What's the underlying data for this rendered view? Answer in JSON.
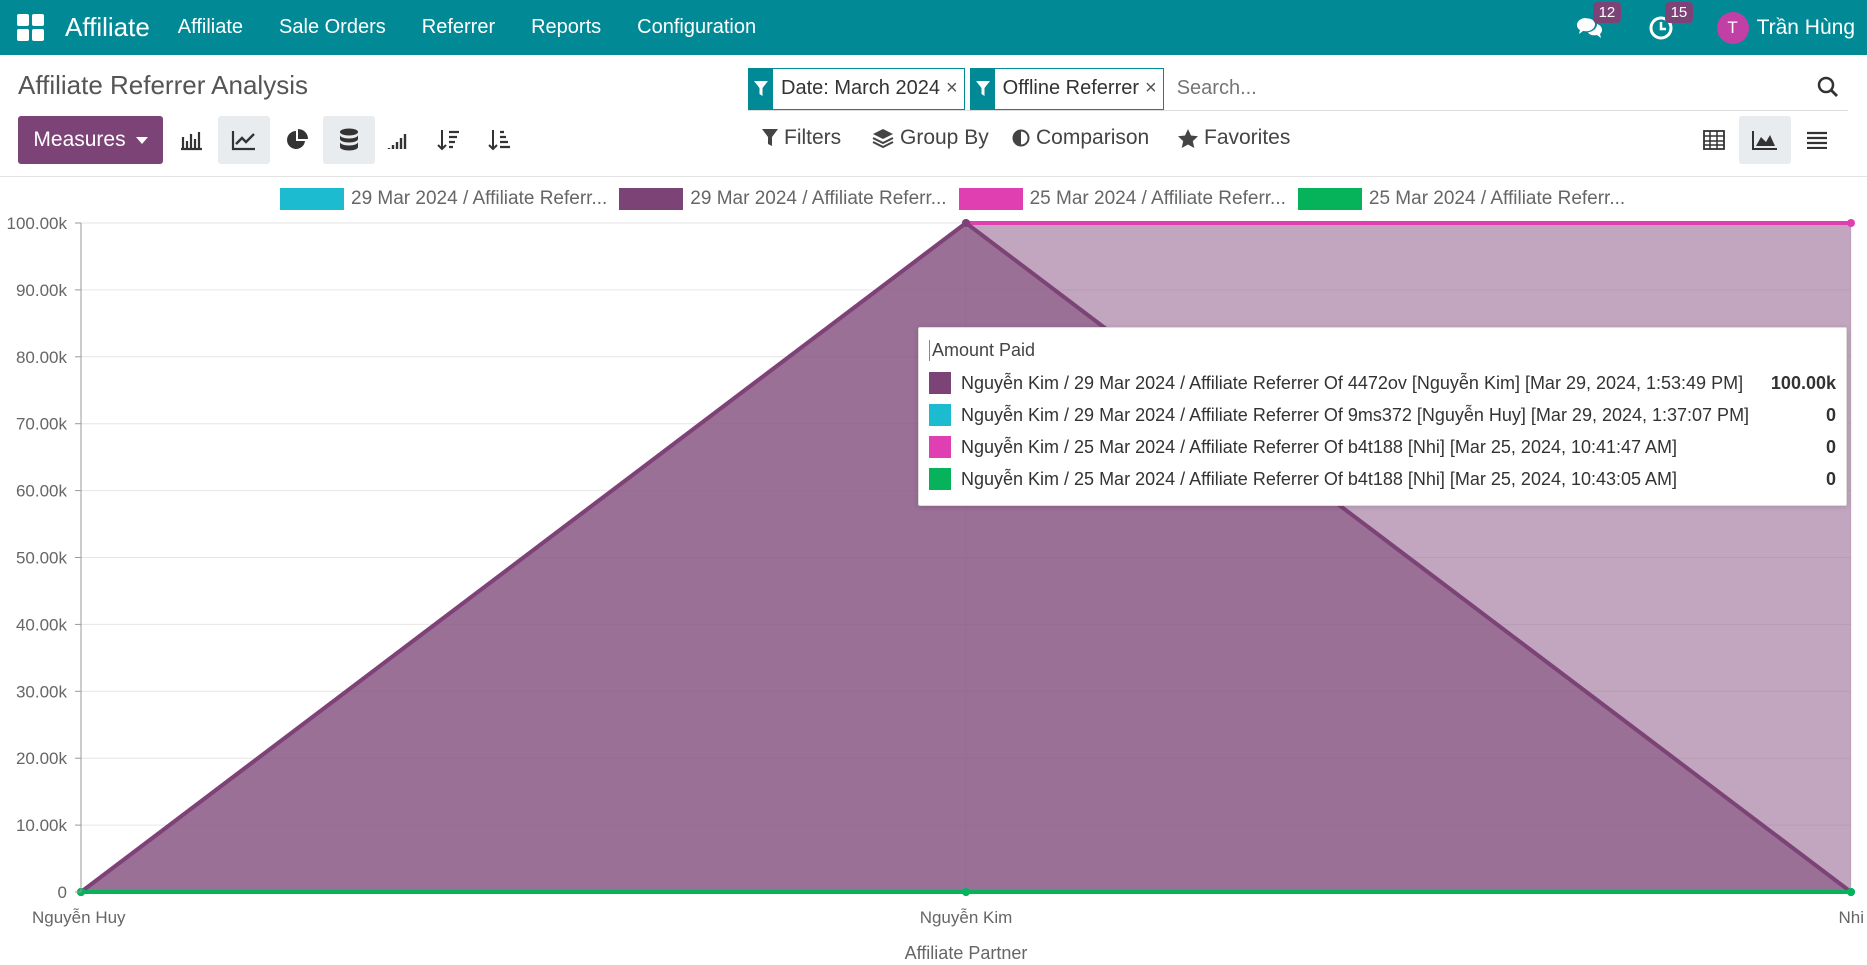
{
  "app": {
    "brand": "Affiliate",
    "nav": [
      "Affiliate",
      "Sale Orders",
      "Referrer",
      "Reports",
      "Configuration"
    ],
    "messages_count": "12",
    "activities_count": "15",
    "user_initial": "T",
    "user_name": "Trần Hùng"
  },
  "page": {
    "title": "Affiliate Referrer Analysis",
    "facets": [
      "Date: March 2024",
      "Offline Referrer"
    ],
    "search_placeholder": "Search...",
    "measures_label": "Measures",
    "filters_label": "Filters",
    "groupby_label": "Group By",
    "comparison_label": "Comparison",
    "favorites_label": "Favorites"
  },
  "colors": {
    "topbar": "#018a96",
    "primary": "#7c4377",
    "cyan": "#1cbbd0",
    "purple": "#7c4377",
    "magenta": "#df3fb0",
    "green": "#06b35a"
  },
  "chart_data": {
    "type": "area",
    "categories": [
      "Nguyễn Huy",
      "Nguyễn Kim",
      "Nhi"
    ],
    "xlabel": "Affiliate Partner",
    "ylim": [
      0,
      100000
    ],
    "yticks": [
      "0",
      "10.00k",
      "20.00k",
      "30.00k",
      "40.00k",
      "50.00k",
      "60.00k",
      "70.00k",
      "80.00k",
      "90.00k",
      "100.00k"
    ],
    "series": [
      {
        "name": "29 Mar 2024 / Affiliate Referr...",
        "color": "#1cbbd0",
        "values": [
          0,
          0,
          0
        ]
      },
      {
        "name": "29 Mar 2024 / Affiliate Referr...",
        "color": "#7c4377",
        "values": [
          0,
          100000,
          0
        ]
      },
      {
        "name": "25 Mar 2024 / Affiliate Referr...",
        "color": "#df3fb0",
        "values": [
          0,
          100000,
          100000
        ]
      },
      {
        "name": "25 Mar 2024 / Affiliate Referr...",
        "color": "#06b35a",
        "values": [
          0,
          0,
          0
        ]
      }
    ]
  },
  "tooltip": {
    "title": "Amount Paid",
    "rows": [
      {
        "label": "Nguyễn Kim / 29 Mar 2024 / Affiliate Referrer Of 4472ov [Nguyễn Kim] [Mar 29, 2024, 1:53:49 PM]",
        "value": "100.00k",
        "color": "#7c4377"
      },
      {
        "label": "Nguyễn Kim / 29 Mar 2024 / Affiliate Referrer Of 9ms372 [Nguyễn Huy] [Mar 29, 2024, 1:37:07 PM]",
        "value": "0",
        "color": "#1cbbd0"
      },
      {
        "label": "Nguyễn Kim / 25 Mar 2024 / Affiliate Referrer Of b4t188 [Nhi] [Mar 25, 2024, 10:41:47 AM]",
        "value": "0",
        "color": "#df3fb0"
      },
      {
        "label": "Nguyễn Kim / 25 Mar 2024 / Affiliate Referrer Of b4t188 [Nhi] [Mar 25, 2024, 10:43:05 AM]",
        "value": "0",
        "color": "#06b35a"
      }
    ]
  }
}
